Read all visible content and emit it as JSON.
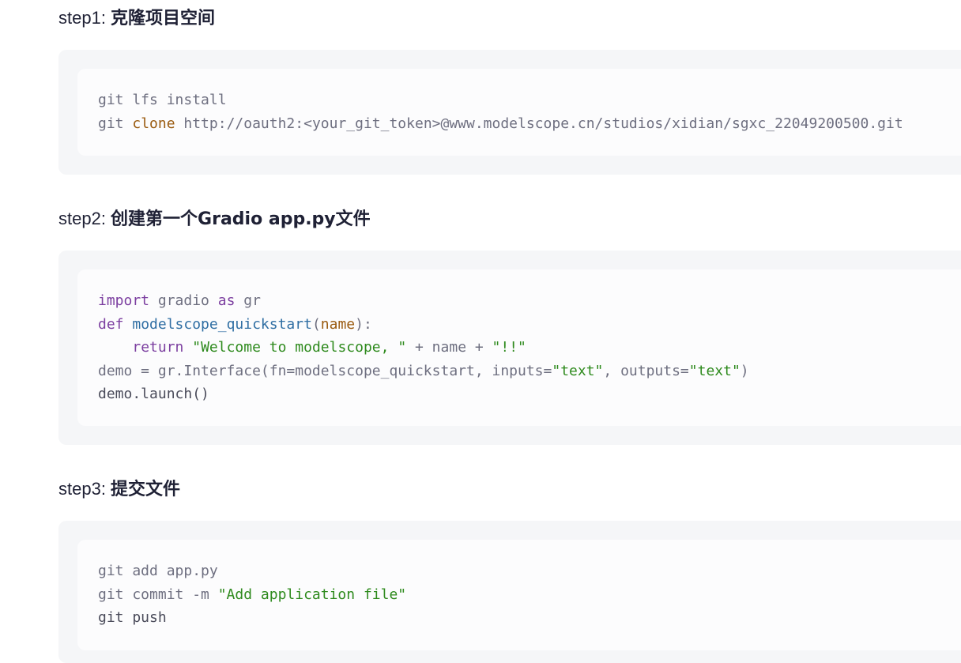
{
  "steps": [
    {
      "prefix": "step1: ",
      "title": "克隆项目空间",
      "code": [
        {
          "segments": [
            {
              "text": "git lfs install",
              "style": "plain"
            }
          ]
        },
        {
          "segments": [
            {
              "text": "git ",
              "style": "plain"
            },
            {
              "text": "clone",
              "style": "cmd"
            },
            {
              "text": " http://oauth2:<your_git_token>@www.modelscope.cn/studios/xidian/sgxc_22049200500.git",
              "style": "plain"
            }
          ]
        }
      ]
    },
    {
      "prefix": "step2: ",
      "title": "创建第一个Gradio app.py文件",
      "code": [
        {
          "segments": [
            {
              "text": "import",
              "style": "kw"
            },
            {
              "text": " gradio ",
              "style": "plain"
            },
            {
              "text": "as",
              "style": "kw"
            },
            {
              "text": " gr",
              "style": "plain"
            }
          ]
        },
        {
          "segments": [
            {
              "text": "def",
              "style": "kw"
            },
            {
              "text": " ",
              "style": "plain"
            },
            {
              "text": "modelscope_quickstart",
              "style": "fn"
            },
            {
              "text": "(",
              "style": "plain"
            },
            {
              "text": "name",
              "style": "param"
            },
            {
              "text": "):",
              "style": "plain"
            }
          ]
        },
        {
          "segments": [
            {
              "text": "    ",
              "style": "plain"
            },
            {
              "text": "return",
              "style": "kw"
            },
            {
              "text": " ",
              "style": "plain"
            },
            {
              "text": "\"Welcome to modelscope, \"",
              "style": "str"
            },
            {
              "text": " + name + ",
              "style": "plain"
            },
            {
              "text": "\"!!\"",
              "style": "str"
            }
          ]
        },
        {
          "segments": [
            {
              "text": "demo = gr.Interface(fn=modelscope_quickstart, inputs=",
              "style": "plain"
            },
            {
              "text": "\"text\"",
              "style": "str"
            },
            {
              "text": ", outputs=",
              "style": "plain"
            },
            {
              "text": "\"text\"",
              "style": "str"
            },
            {
              "text": ")",
              "style": "plain"
            }
          ]
        },
        {
          "segments": [
            {
              "text": "demo.launch()",
              "style": "dark"
            }
          ]
        }
      ]
    },
    {
      "prefix": "step3: ",
      "title": "提交文件",
      "code": [
        {
          "segments": [
            {
              "text": "git add app.py",
              "style": "plain"
            }
          ]
        },
        {
          "segments": [
            {
              "text": "git commit -m ",
              "style": "plain"
            },
            {
              "text": "\"Add application file\"",
              "style": "str"
            }
          ]
        },
        {
          "segments": [
            {
              "text": "git push",
              "style": "dark"
            }
          ]
        }
      ]
    }
  ]
}
